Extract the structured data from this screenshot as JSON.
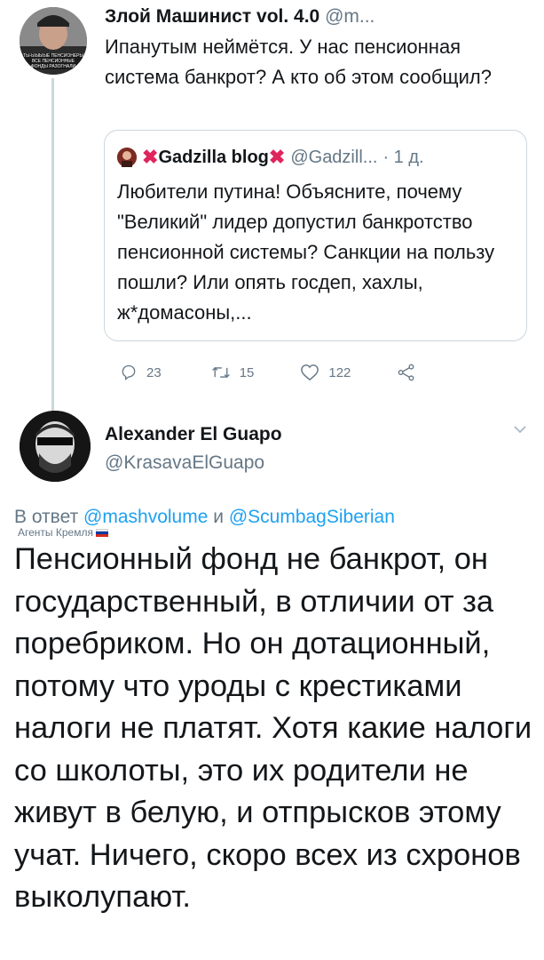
{
  "tweet1": {
    "author_name": "Злой Машинист vol. 4.0",
    "handle": "@m...",
    "avatar_caption": "ТЫ-ЫЫЫЫЕ ПЕНСИОНЕРЫ ВСЕ ПЕНСИОННЫЕ ФОНДЫ РАЗОГНАЛИ",
    "text": "Ипанутым неймётся. У нас пенсионная система банкрот? А кто об этом сообщил?",
    "quoted": {
      "author_name": "Gadzilla blog",
      "handle": "@Gadzill...",
      "time": "· 1 д.",
      "text": "Любители путина! Объясните, почему \"Великий\" лидер допустил банкротство пенсионной системы? Санкции на пользу пошли? Или опять госдеп, хахлы, ж*домасоны,..."
    },
    "actions": {
      "reply_count": "23",
      "retweet_count": "15",
      "like_count": "122"
    }
  },
  "tweet2": {
    "author_name": "Alexander El Guapo",
    "handle": "@KrasavaElGuapo",
    "reply_prefix": "В ответ ",
    "reply_user1": "@mashvolume",
    "reply_joiner": " и ",
    "reply_user2": "@ScumbagSiberian",
    "label": "Агенты Кремля",
    "text": "Пенсионный фонд не банкрот, он государственный, в отличии от за поребриком. Но он дотационный, потому что уроды с крестиками налоги не платят. Хотя какие налоги со школоты, это их родители не живут в белую, и отпрысков этому учат. Ничего, скоро всех из схронов выколупают."
  },
  "colors": {
    "link": "#1da1f2",
    "secondary_text": "#657786",
    "border": "#ccd6dd",
    "red_x": "#e0245e"
  }
}
